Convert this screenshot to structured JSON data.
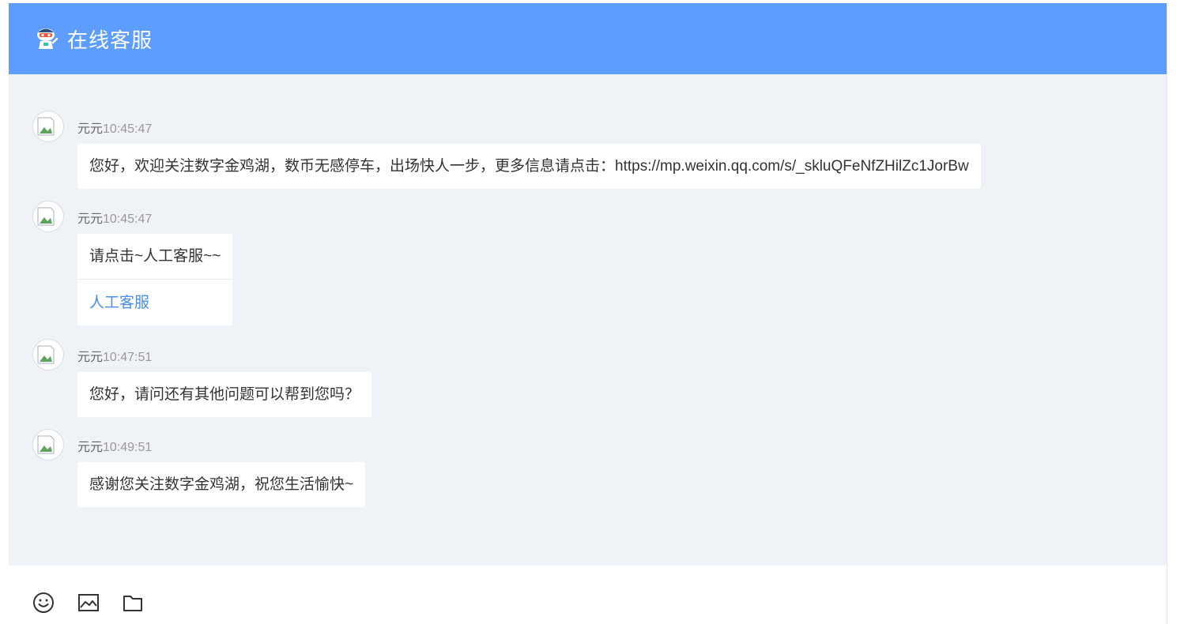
{
  "header": {
    "title": "在线客服",
    "icon": "robot-mascot-icon"
  },
  "messages": [
    {
      "name": "元元",
      "time": "10:45:47",
      "text": "您好，欢迎关注数字金鸡湖，数币无感停车，出场快人一步，更多信息请点击：https://mp.weixin.qq.com/s/_skluQFeNfZHilZc1JorBw"
    },
    {
      "name": "元元",
      "time": "10:45:47",
      "text": "请点击~人工客服~~",
      "link": "人工客服"
    },
    {
      "name": "元元",
      "time": "10:47:51",
      "text": "您好，请问还有其他问题可以帮到您吗？"
    },
    {
      "name": "元元",
      "time": "10:49:51",
      "text": "感谢您关注数字金鸡湖，祝您生活愉快~"
    }
  ],
  "toolbar": {
    "icons": [
      "emoji-icon",
      "image-icon",
      "folder-icon"
    ]
  },
  "colors": {
    "header": "#5c9dff",
    "chat_bg": "#eff2f7",
    "link": "#4a8cf0"
  }
}
